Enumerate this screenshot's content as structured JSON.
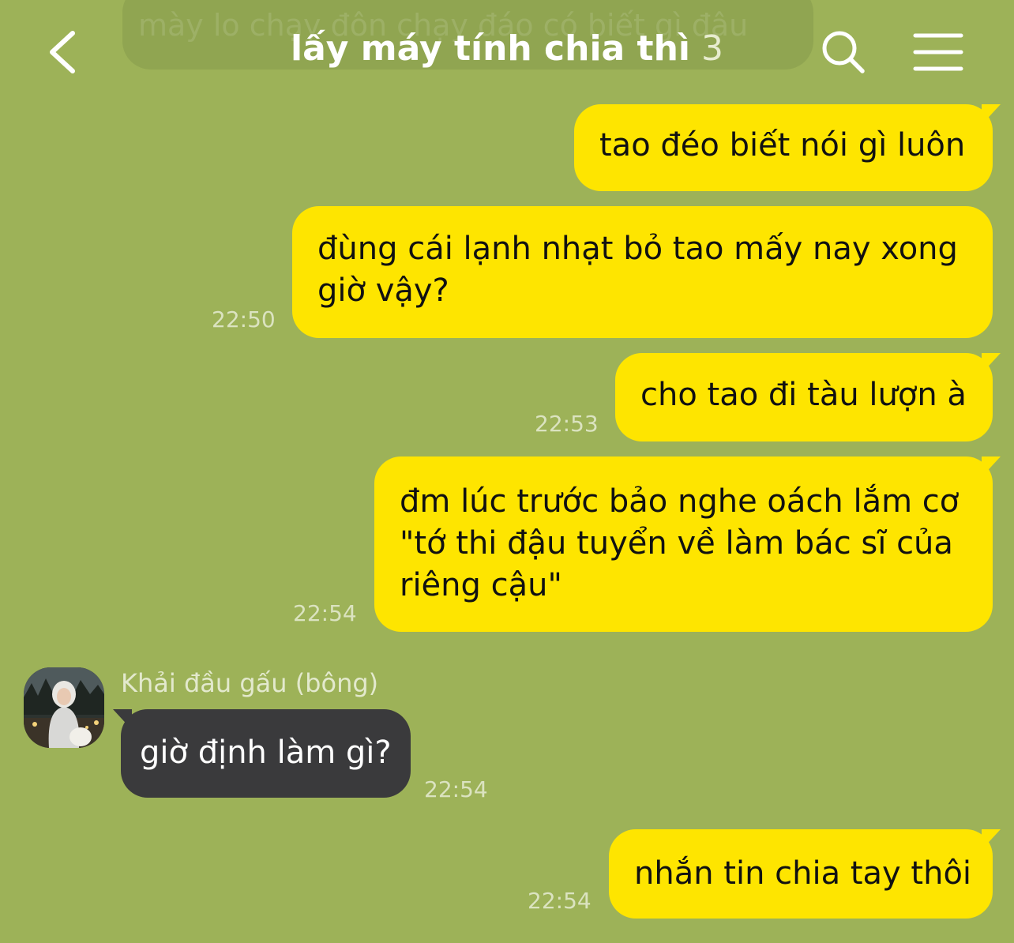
{
  "ghost_text": "mày lo chạy đôn chạy đáo có biết gì đâu",
  "header": {
    "title": "lấy máy tính chia thì",
    "member_count": "3"
  },
  "icons": {
    "back": "chevron-left-icon",
    "search": "search-icon",
    "menu": "hamburger-menu-icon"
  },
  "colors": {
    "background": "#9db258",
    "my_bubble": "#fee500",
    "their_bubble": "#3a3a3c"
  },
  "messages": [
    {
      "from": "me",
      "text": "tao đéo biết nói gì luôn",
      "time": ""
    },
    {
      "from": "me",
      "text": "đùng cái lạnh nhạt bỏ tao mấy nay xong giờ vậy?",
      "time": "22:50"
    },
    {
      "from": "me",
      "text": "cho tao đi tàu lượn à",
      "time": "22:53"
    },
    {
      "from": "me",
      "text": "đm lúc trước bảo nghe oách lắm cơ \"tớ thi đậu tuyển về làm bác sĩ của riêng cậu\"",
      "time": "22:54"
    },
    {
      "from": "Khải đầu gấu (bông)",
      "text": "giờ định làm gì?",
      "time": "22:54"
    },
    {
      "from": "me",
      "text": "nhắn tin chia tay thôi",
      "time": "22:54"
    }
  ],
  "other_sender": {
    "name": "Khải đầu gấu (bông)"
  }
}
